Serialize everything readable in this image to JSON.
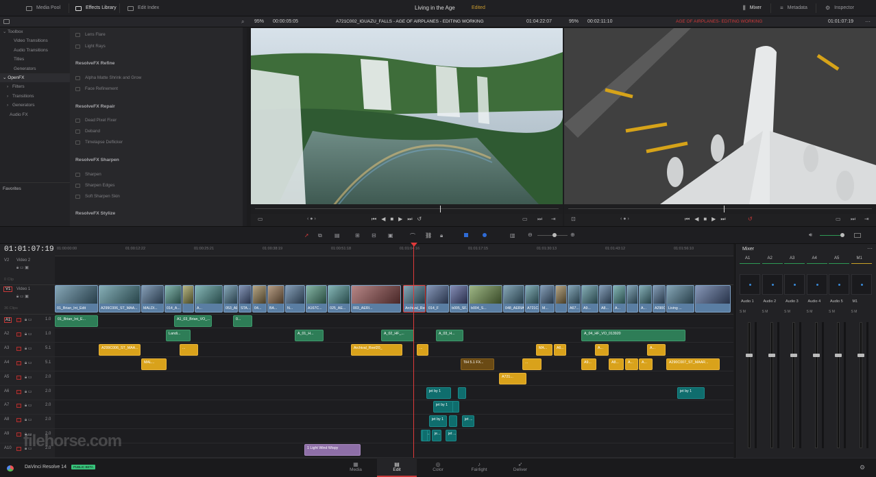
{
  "topbar": {
    "media_pool": "Media Pool",
    "effects_library": "Effects Library",
    "edit_index": "Edit Index",
    "project_title": "Living in the Age",
    "status": "Edited",
    "mixer": "Mixer",
    "metadata": "Metadata",
    "inspector": "Inspector"
  },
  "source_viewer": {
    "zoom": "95%",
    "timecode_left": "00:00:05:05",
    "clip_name": "A721C002_IGUAZU_FALLS - AGE OF AIRPLANES - EDITING WORKING",
    "timecode_right": "01:04:22:07"
  },
  "timeline_viewer": {
    "zoom": "95%",
    "timecode_left": "00:02:11:10",
    "clip_name": "AGE OF AIRPLANES- EDITING WORKING",
    "timecode_right": "01:01:07:19"
  },
  "toolbox": {
    "items": [
      "Toolbox",
      "Video Transitions",
      "Audio Transitions",
      "Titles",
      "Generators",
      "OpenFX",
      "Filters",
      "Transitions",
      "Generators",
      "Audio FX"
    ],
    "favorites": "Favorites"
  },
  "effects": {
    "items_top": [
      "Lens Flare",
      "Light Rays"
    ],
    "refine_header": "ResolveFX Refine",
    "refine": [
      "Alpha Matte Shrink and Grow",
      "Face Refinement"
    ],
    "repair_header": "ResolveFX Repair",
    "repair": [
      "Dead Pixel Fixer",
      "Deband",
      "Timelapse Deflicker"
    ],
    "sharpen_header": "ResolveFX Sharpen",
    "sharpen": [
      "Sharpen",
      "Sharpen Edges",
      "Soft Sharpen Skin"
    ],
    "stylize_header": "ResolveFX Stylize"
  },
  "timeline": {
    "timecode": "01:01:07:19",
    "ruler": [
      "01:00:00:00",
      "01:00:12:22",
      "01:00:25:21",
      "01:00:38:19",
      "01:00:51:18",
      "01:01:04:16",
      "01:01:17:15",
      "01:01:30:13",
      "01:01:43:12",
      "01:01:56:10"
    ],
    "video_tracks": [
      {
        "id": "V2",
        "name": "Video 2",
        "clips": "0 Clip"
      },
      {
        "id": "V1",
        "name": "Video 1",
        "clips": "36 Clips"
      }
    ],
    "audio_tracks": [
      {
        "id": "A1",
        "level": "1.0"
      },
      {
        "id": "A2",
        "level": "1.0"
      },
      {
        "id": "A3",
        "level": "5.1"
      },
      {
        "id": "A4",
        "level": "5.1"
      },
      {
        "id": "A5",
        "level": "2.0"
      },
      {
        "id": "A6",
        "level": "2.0"
      },
      {
        "id": "A7",
        "level": "2.0"
      },
      {
        "id": "A8",
        "level": "2.0"
      },
      {
        "id": "A9",
        "level": "2.0"
      },
      {
        "id": "A10",
        "level": "2.0"
      }
    ],
    "video_clips": [
      "01_Brian_Int_Edit",
      "A299C006_ST_MAA...",
      "MALDI...",
      "014_A...",
      "A...",
      "053_AERIAL...",
      "STA...",
      "04...",
      "BA...",
      "N...",
      "A167C...",
      "025_AE...",
      "003_AERI...",
      "Archival_Reel20_",
      "014_F",
      "b005_SF...",
      "b004_S...",
      "048_AERIAL_K...",
      "A721C...",
      "M...",
      "A67...",
      "A9...",
      "A8...",
      "A...",
      "A...",
      "A290C007...",
      "Living ..."
    ],
    "audio_clips": {
      "a1": [
        "01_Brian_Int_E...",
        "A1_03_Brian_VO_...",
        "0..."
      ],
      "a2": [
        "Landi...",
        "A_01_H...",
        "A_02_HF_...",
        "A_03_H...",
        "A_04_HF_VO_013920"
      ],
      "a3": [
        "A299C006_ST_MAA...",
        "...",
        "Archival_Reel20_",
        "...",
        "MA...",
        "A6...",
        "A...",
        "A..."
      ],
      "a4": [
        "MAL...",
        "TiH 5.1 FX...",
        "...",
        "A9...",
        "A8...",
        "A...",
        "A...",
        "A290C007_ST_MAAR..."
      ],
      "a5": [
        "A721..."
      ],
      "a6": [
        "jet by 1",
        "jet by 1"
      ],
      "a7": [
        "jet by 1"
      ],
      "a8": [
        "jet by 1",
        "jet ..."
      ],
      "a9": [
        "je...",
        "je...",
        "jet ..."
      ],
      "a10": [
        "1 Light Wind Wispy"
      ]
    }
  },
  "mixer": {
    "title": "Mixer",
    "channels": [
      "A1",
      "A2",
      "A3",
      "A4",
      "A5",
      "M1"
    ],
    "audio_labels": [
      "Audio 1",
      "Audio 2",
      "Audio 3",
      "Audio 4",
      "Audio 5",
      "M1"
    ]
  },
  "bottom": {
    "app_name": "DaVinci Resolve 14",
    "beta": "PUBLIC BETA",
    "pages": [
      "Media",
      "Edit",
      "Color",
      "Fairlight",
      "Deliver"
    ],
    "watermark": "filehorse.com"
  }
}
